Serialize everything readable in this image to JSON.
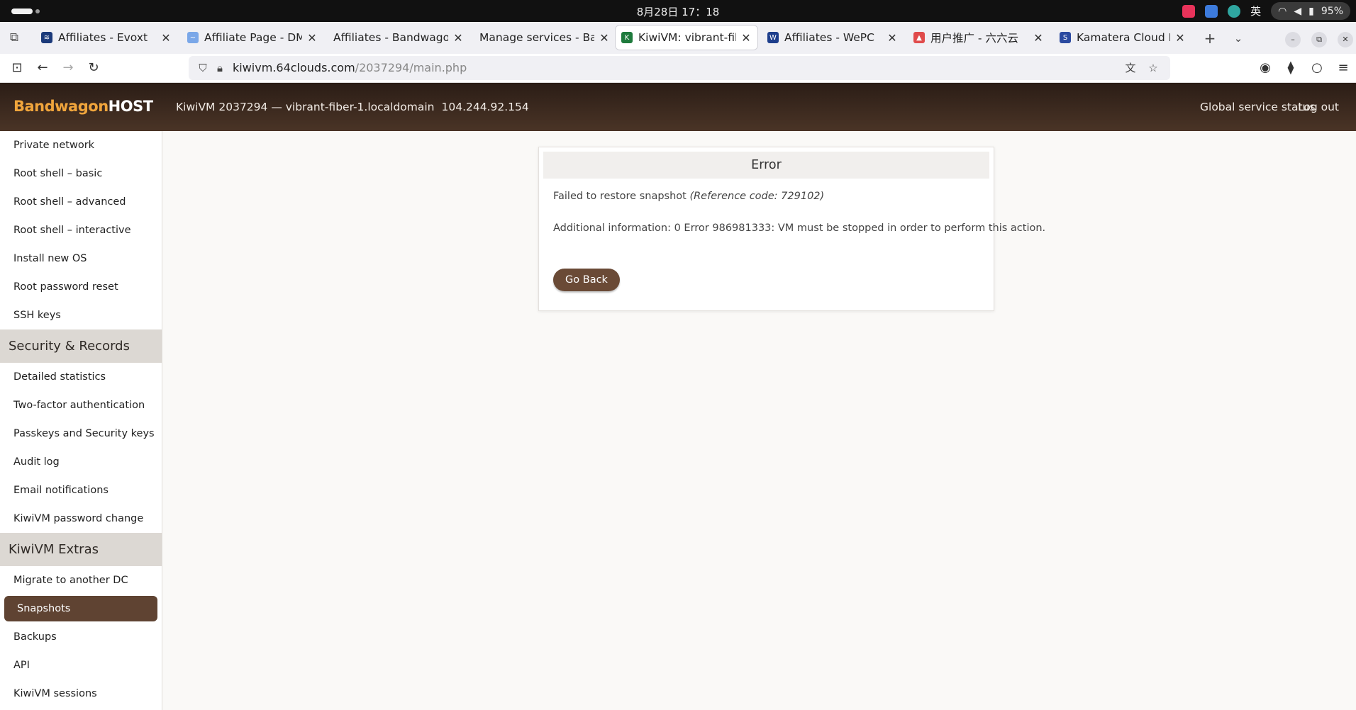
{
  "os": {
    "clock": "8月28日 17：18",
    "ime": "英",
    "battery": "95%",
    "tray_colors": [
      "#e8335a",
      "#3d7bdc",
      "#2fa6a0"
    ]
  },
  "browser": {
    "tabs": [
      {
        "title": "Affiliates - Evoxt",
        "favicon_color": "#1b3a7a",
        "favicon": "evoxt-icon",
        "active": false
      },
      {
        "title": "Affiliate Page - DMIT, I",
        "favicon_color": "#7aa7e8",
        "favicon": "dmit-icon",
        "active": false
      },
      {
        "title": "Affiliates - BandwagonHo",
        "favicon_color": "",
        "favicon": "",
        "active": false
      },
      {
        "title": "Manage services - Bandw",
        "favicon_color": "",
        "favicon": "",
        "active": false
      },
      {
        "title": "KiwiVM: vibrant-fiber-",
        "favicon_color": "#1e7a3c",
        "favicon": "kiwivm-icon",
        "active": true
      },
      {
        "title": "Affiliates - WePC",
        "favicon_color": "#1d3e8c",
        "favicon": "wepc-icon",
        "active": false
      },
      {
        "title": "用户推广 - 六六云",
        "favicon_color": "#e04b4b",
        "favicon": "liuliuyun-icon",
        "active": false
      },
      {
        "title": "Kamatera Cloud Platfo",
        "favicon_color": "#2b4aa0",
        "favicon": "kamatera-icon",
        "active": false
      }
    ],
    "url": {
      "domain": "kiwivm.64clouds.com",
      "path": "/2037294/main.php"
    }
  },
  "header": {
    "logo_primary": "Bandwagon",
    "logo_secondary": "HOST",
    "vm_label": "KiwiVM 2037294 — vibrant-fiber-1.localdomain",
    "vm_ip": "104.244.92.154",
    "global_status": "Global service status",
    "logout": "Log out"
  },
  "sidebar": {
    "group1": [
      "Private network",
      "Root shell – basic",
      "Root shell – advanced",
      "Root shell – interactive",
      "Install new OS",
      "Root password reset",
      "SSH keys"
    ],
    "section2": "Security & Records",
    "group2": [
      "Detailed statistics",
      "Two-factor authentication",
      "Passkeys and Security keys",
      "Audit log",
      "Email notifications",
      "KiwiVM password change"
    ],
    "section3": "KiwiVM Extras",
    "group3": [
      "Migrate to another DC",
      "Snapshots",
      "Backups",
      "API",
      "KiwiVM sessions"
    ],
    "active": "Snapshots"
  },
  "error": {
    "title": "Error",
    "message": "Failed to restore snapshot",
    "reference": "(Reference code: 729102)",
    "info": "Additional information: 0 Error 986981333: VM must be stopped in order to perform this action.",
    "button": "Go Back"
  }
}
